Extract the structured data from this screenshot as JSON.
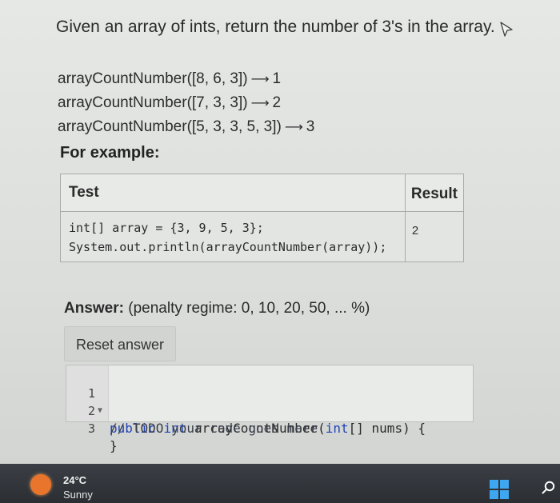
{
  "question": {
    "title": "Given an array of ints, return the number of 3's in the array.",
    "examples": [
      {
        "call": "arrayCountNumber([8, 6, 3])",
        "arrow": "⟶",
        "result": "1"
      },
      {
        "call": "arrayCountNumber([7, 3, 3])",
        "arrow": "⟶",
        "result": "2"
      },
      {
        "call": "arrayCountNumber([5, 3, 3, 5, 3])",
        "arrow": "⟶",
        "result": "3"
      }
    ],
    "for_example_label": "For example:"
  },
  "test_table": {
    "headers": {
      "test": "Test",
      "result": "Result"
    },
    "rows": [
      {
        "code_line1": "int[] array = {3, 9, 5, 3};",
        "code_line2": "System.out.println(arrayCountNumber(array));",
        "result": "2"
      }
    ]
  },
  "answer": {
    "label": "Answer:",
    "penalty": "(penalty regime: 0, 10, 20, 50, ... %)",
    "reset_label": "Reset answer"
  },
  "editor": {
    "lines": [
      {
        "num": "1",
        "kw1": "public",
        "kw2": "int",
        "name": " arrayCountNumber(",
        "kw3": "int",
        "rest": "[] nums) {"
      },
      {
        "num": "2",
        "comment": "// TODO your code goes here"
      },
      {
        "num": "3",
        "text": "}"
      }
    ]
  },
  "taskbar": {
    "temperature": "24°C",
    "condition": "Sunny"
  },
  "icons": {
    "cursor": "mouse-pointer-icon",
    "weather": "sun-weather-icon",
    "start": "windows-start-icon",
    "search": "search-icon"
  }
}
